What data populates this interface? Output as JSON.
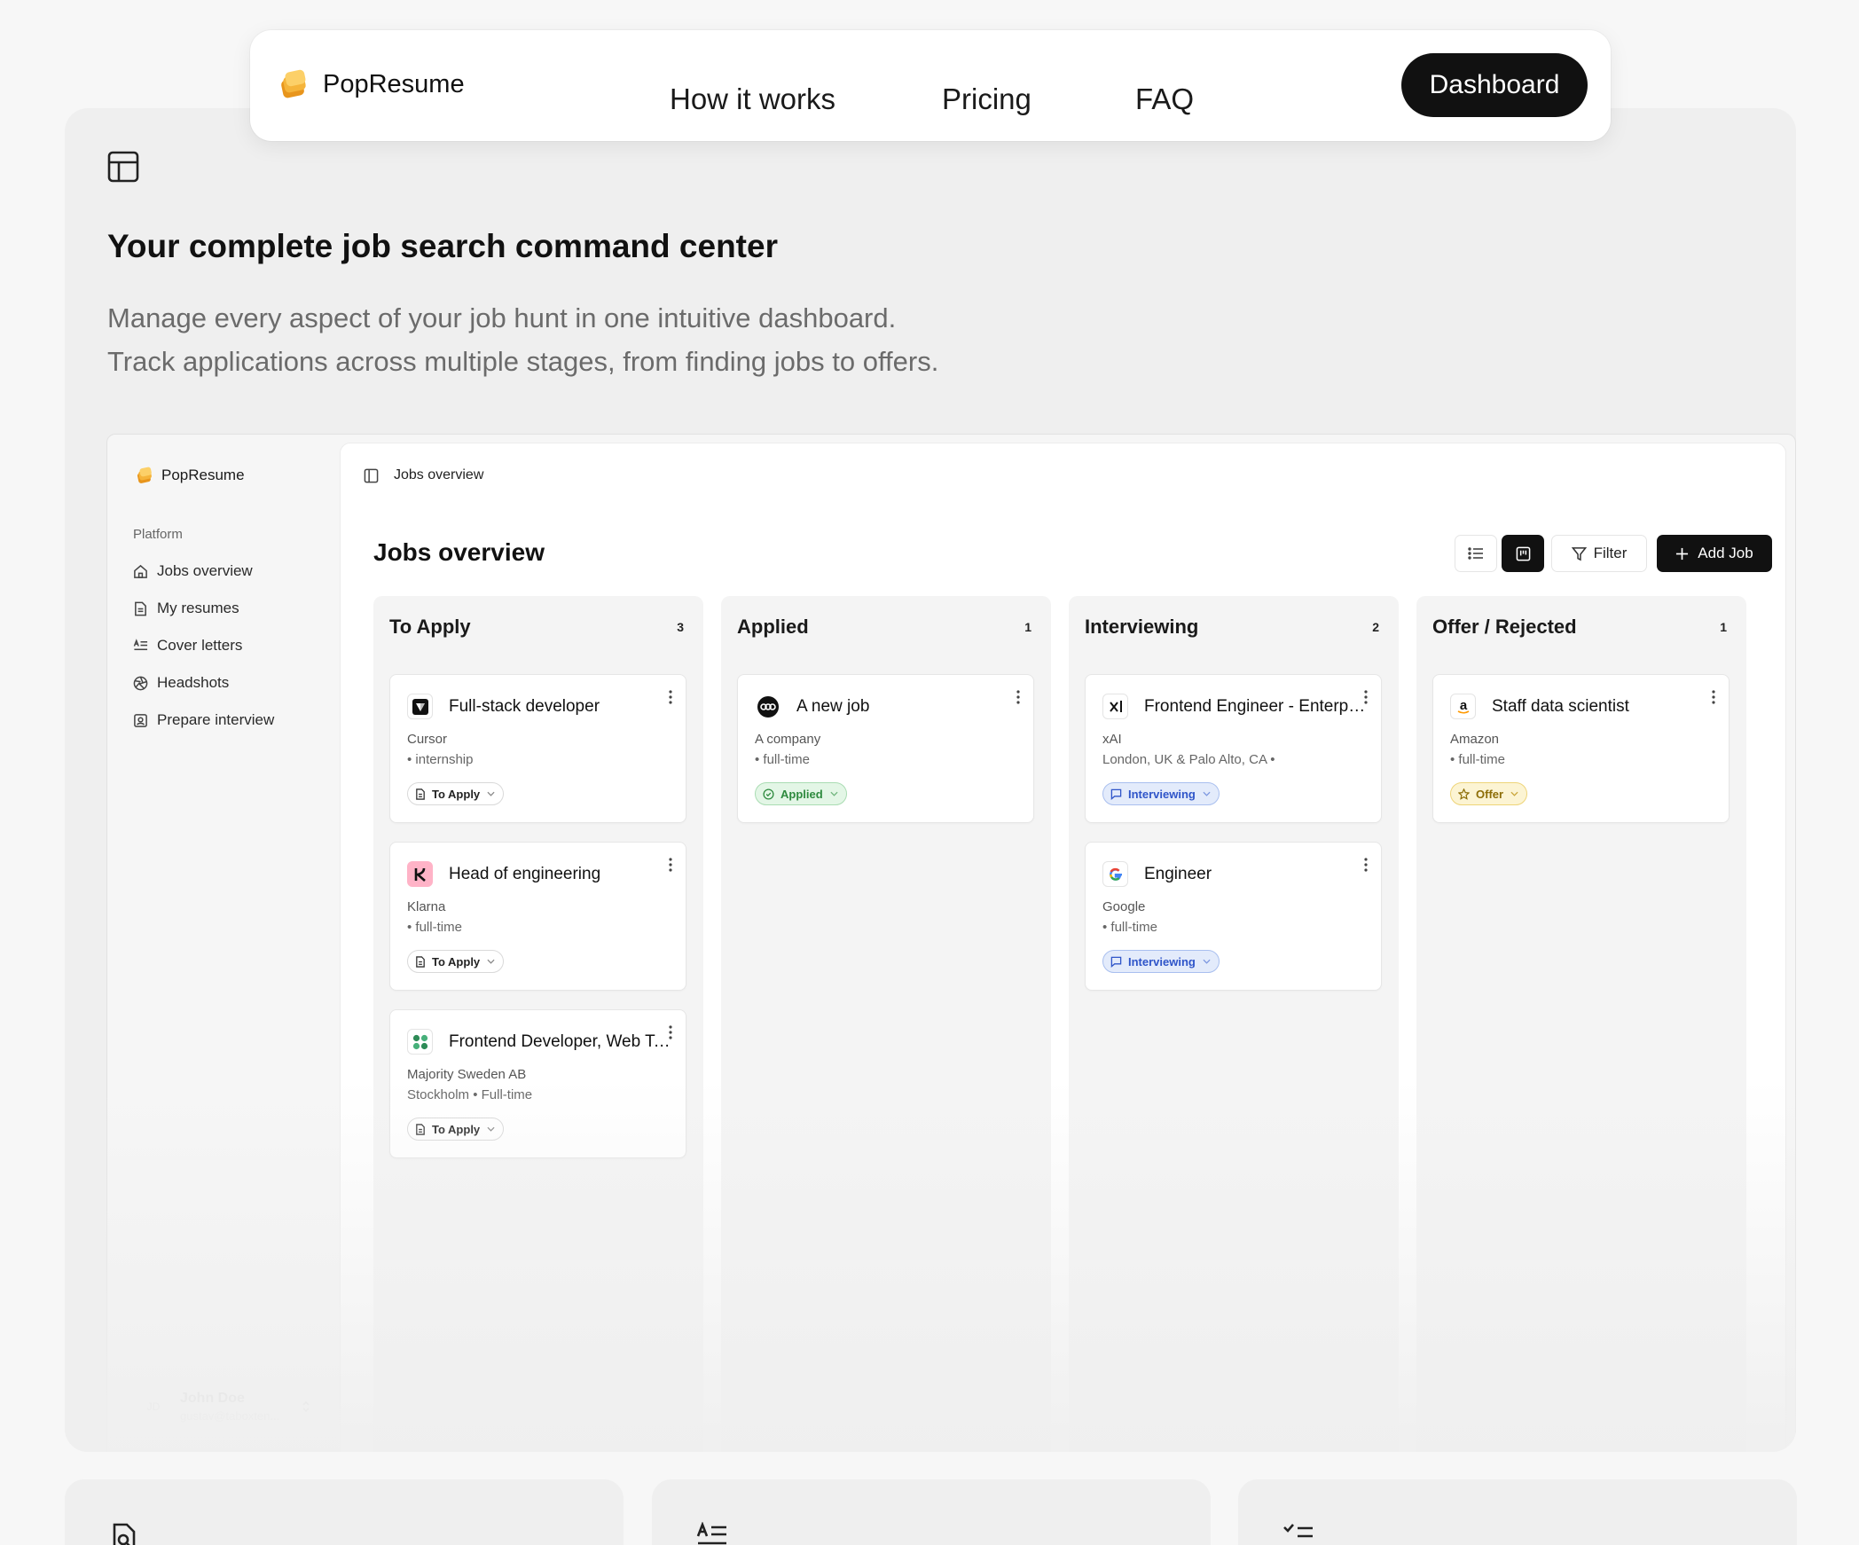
{
  "nav": {
    "brand": "PopResume",
    "links": [
      "How it works",
      "Pricing",
      "FAQ"
    ],
    "cta": "Dashboard"
  },
  "hero": {
    "icon": "layout-icon",
    "title": "Your complete job search command center",
    "subtitle_lines": [
      "Manage every aspect of your job hunt in one intuitive dashboard.",
      "Track applications across multiple stages, from finding jobs to offers."
    ]
  },
  "app": {
    "brand": "PopResume",
    "sidebar": {
      "section": "Platform",
      "items": [
        {
          "label": "Jobs overview",
          "icon": "home-icon"
        },
        {
          "label": "My resumes",
          "icon": "resume-file-icon"
        },
        {
          "label": "Cover letters",
          "icon": "text-lines-icon"
        },
        {
          "label": "Headshots",
          "icon": "aperture-icon"
        },
        {
          "label": "Prepare interview",
          "icon": "contact-icon"
        }
      ],
      "user": {
        "initials": "JD",
        "name": "John Doe",
        "email": "gustav@taboxten..."
      }
    },
    "breadcrumb": "Jobs overview",
    "page_title": "Jobs overview",
    "toolbar": {
      "filter": "Filter",
      "add": "Add Job"
    },
    "columns": [
      {
        "title": "To Apply",
        "count": "3",
        "cards": [
          {
            "title": "Full-stack developer",
            "company": "Cursor",
            "meta": "• internship",
            "status": "To Apply",
            "logo": "cursor-logo"
          },
          {
            "title": "Head of engineering",
            "company": "Klarna",
            "meta": "• full-time",
            "status": "To Apply",
            "logo": "klarna-logo"
          },
          {
            "title": "Frontend Developer, Web Team",
            "company": "Majority Sweden AB",
            "meta": "Stockholm • Full-time",
            "status": "To Apply",
            "logo": "majority-logo"
          }
        ]
      },
      {
        "title": "Applied",
        "count": "1",
        "cards": [
          {
            "title": "A new job",
            "company": "A company",
            "meta": "• full-time",
            "status": "Applied",
            "logo": "abc-logo"
          }
        ]
      },
      {
        "title": "Interviewing",
        "count": "2",
        "cards": [
          {
            "title": "Frontend Engineer - Enterprise",
            "company": "xAI",
            "meta": "London, UK & Palo Alto, CA •",
            "status": "Interviewing",
            "logo": "xai-logo"
          },
          {
            "title": "Engineer",
            "company": "Google",
            "meta": "• full-time",
            "status": "Interviewing",
            "logo": "google-logo"
          }
        ]
      },
      {
        "title": "Offer / Rejected",
        "count": "1",
        "cards": [
          {
            "title": "Staff data scientist",
            "company": "Amazon",
            "meta": "• full-time",
            "status": "Offer",
            "logo": "amazon-logo"
          }
        ]
      }
    ]
  },
  "features": [
    {
      "icon": "file-search-icon"
    },
    {
      "icon": "text-lines-icon"
    },
    {
      "icon": "checklist-icon"
    }
  ],
  "colors": {
    "page_bg": "#f7f7f7",
    "panel_bg": "#efefef",
    "primary": "#111111",
    "applied": "#2e8a3e",
    "interviewing": "#2f55c9",
    "offer": "#8d6d06"
  }
}
